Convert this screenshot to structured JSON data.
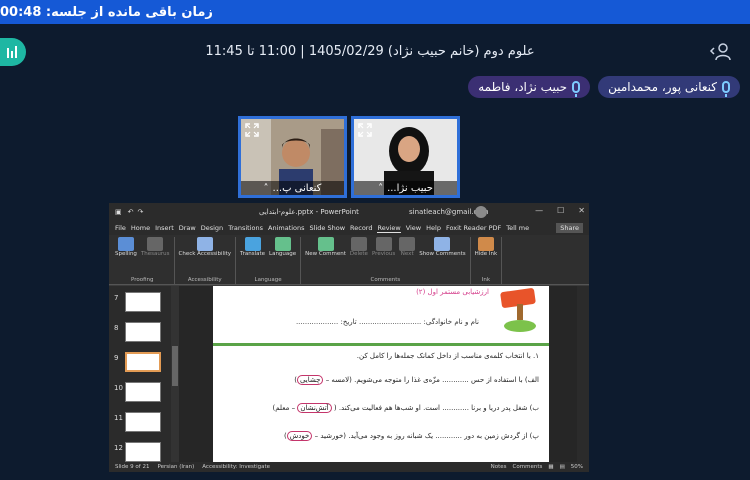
{
  "timer": {
    "label": "زمان باقی مانده از جلسه:",
    "value": "00:48"
  },
  "session": {
    "title": "علوم دوم (خانم حبیب نژاد) 1405/02/29 | 11:00 تا 11:45"
  },
  "participants": [
    {
      "name": "حبیب نژاد، فاطمه"
    },
    {
      "name": "کنعانی پور، محمدامین"
    }
  ],
  "videos": [
    {
      "label": "حبیب نژا..."
    },
    {
      "label": "کنعانی پ..."
    }
  ],
  "ppt": {
    "doc_name": "علوم-ابتدایی.pptx - PowerPoint",
    "email": "sinatleach@gmail.com",
    "window_controls": [
      "—",
      "☐",
      "✕"
    ],
    "menu": [
      "File",
      "Home",
      "Insert",
      "Draw",
      "Design",
      "Transitions",
      "Animations",
      "Slide Show",
      "Record",
      "Review",
      "View",
      "Help",
      "Foxit Reader PDF",
      "Tell me"
    ],
    "active_menu": "Review",
    "share_label": "Share",
    "ribbon_groups": [
      {
        "name": "Proofing",
        "buttons": [
          {
            "label": "Spelling",
            "dim": false
          },
          {
            "label": "Thesaurus",
            "dim": true
          }
        ]
      },
      {
        "name": "Accessibility",
        "buttons": [
          {
            "label": "Check Accessibility",
            "dim": false
          }
        ]
      },
      {
        "name": "Language",
        "buttons": [
          {
            "label": "Translate",
            "dim": false
          },
          {
            "label": "Language",
            "dim": false
          }
        ]
      },
      {
        "name": "Comments",
        "buttons": [
          {
            "label": "New Comment",
            "dim": false
          },
          {
            "label": "Delete",
            "dim": true
          },
          {
            "label": "Previous",
            "dim": true
          },
          {
            "label": "Next",
            "dim": true
          },
          {
            "label": "Show Comments",
            "dim": false
          }
        ]
      },
      {
        "name": "Ink",
        "buttons": [
          {
            "label": "Hide Ink",
            "dim": false
          }
        ]
      }
    ],
    "thumbnails": [
      "7",
      "8",
      "9",
      "10",
      "11",
      "12"
    ],
    "selected_thumb": "9",
    "slide": {
      "subtitle": "ارزشیابی مستمر اول (۲)",
      "name_line": "نام و نام خانوادگی: ............................   تاریخ: ...................",
      "instruction": "۱. با انتخاب کلمه‌ی مناسب از داخل کمانک جمله‌ها را کامل کن.",
      "q1": "الف) با استفاده از حس ............ مزّه‌ی غذا را متوجه می‌شویم. (لامسه –",
      "q1_answer": "چشایی",
      "q2": "ب) شغل پدر دریا و برنا ............ است. او شب‌ها هم فعالیت می‌کند. (",
      "q2_answer": "آتش‌نشان",
      "q2_rest": "– معلم)",
      "q3": "پ) از گردش زمین به دور ............ یک شبانه روز به وجود می‌آید. (خورشید –",
      "q3_answer": "خودش"
    },
    "status": {
      "slide_of": "Slide 9 of 21",
      "language": "Persian (Iran)",
      "accessibility": "Accessibility: Investigate",
      "notes": "Notes",
      "comments": "Comments",
      "zoom": "50%"
    }
  }
}
